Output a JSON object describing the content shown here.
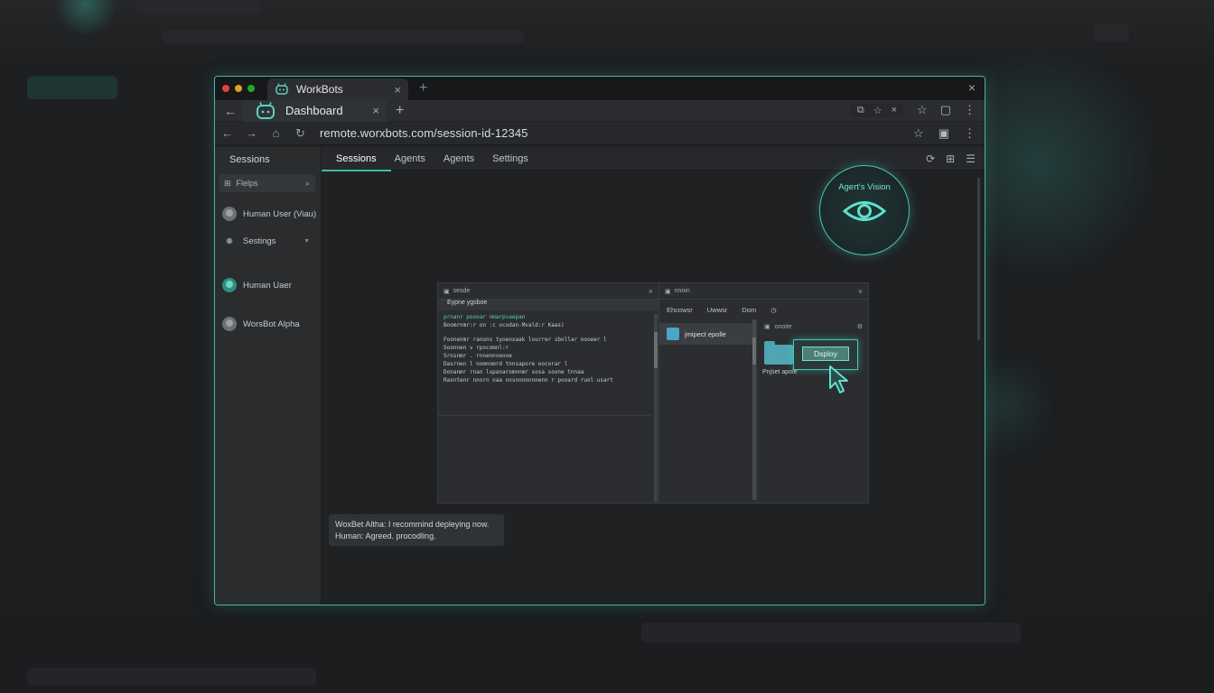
{
  "browser": {
    "tab1_title": "WorkBots",
    "tab1_close": "×",
    "new_tab": "+",
    "window_close": "×",
    "tab2_title": "Dashboard",
    "tab2_close": "×",
    "url": "remote.worxbots.com/session-id-12345"
  },
  "sidebar": {
    "title": "Sessions",
    "search_placeholder": "Flelps",
    "items": [
      {
        "label": "Human User (Viau)"
      },
      {
        "label": "Sestings"
      },
      {
        "label": "Human Uaer"
      },
      {
        "label": "WorsBot Alpha"
      }
    ]
  },
  "topnav": {
    "tabs": [
      "Sessions",
      "Agents",
      "Agents",
      "Settings"
    ]
  },
  "vision": {
    "label": "Agert's Vision"
  },
  "inner": {
    "left_header": "sesde",
    "code_tabs": "Eypne   ygsboe",
    "code_lines": [
      "prnanr poonar nmarpvaepan",
      "Boomrnmr:r on :c ocodan-Mvald:r Kaas)",
      "",
      "Foonenmr ranons tyoenxaak lourrer sbollar oooeer l",
      "Soonnen v rpocomnl:r",
      "Srnsnmr . rnnennvenoe",
      "Dasrnen  l nomnnmrd tnnsapore oocorar l",
      "Donanmr  rnan   lspanaromnnmr sosa soone tnnaa",
      "Rasntenr nnorn  naa nnsnnnnnnnenn r pooard ruol usart"
    ],
    "right_header": "nnoin",
    "fm_tools": [
      "Ehcowsr",
      "Uwwsr",
      "Dom"
    ],
    "fm_row": "jmipect epolle",
    "detail_header": "onoite",
    "folder_label": "Pnjset apole",
    "deploy": "Dsploy"
  },
  "chat": {
    "line1": "WoxBet Altha: I recommind depleying now.",
    "line2": "Human: Agreed. procodling."
  },
  "colors": {
    "accent": "#43c9b6",
    "background": "#1f2123"
  }
}
